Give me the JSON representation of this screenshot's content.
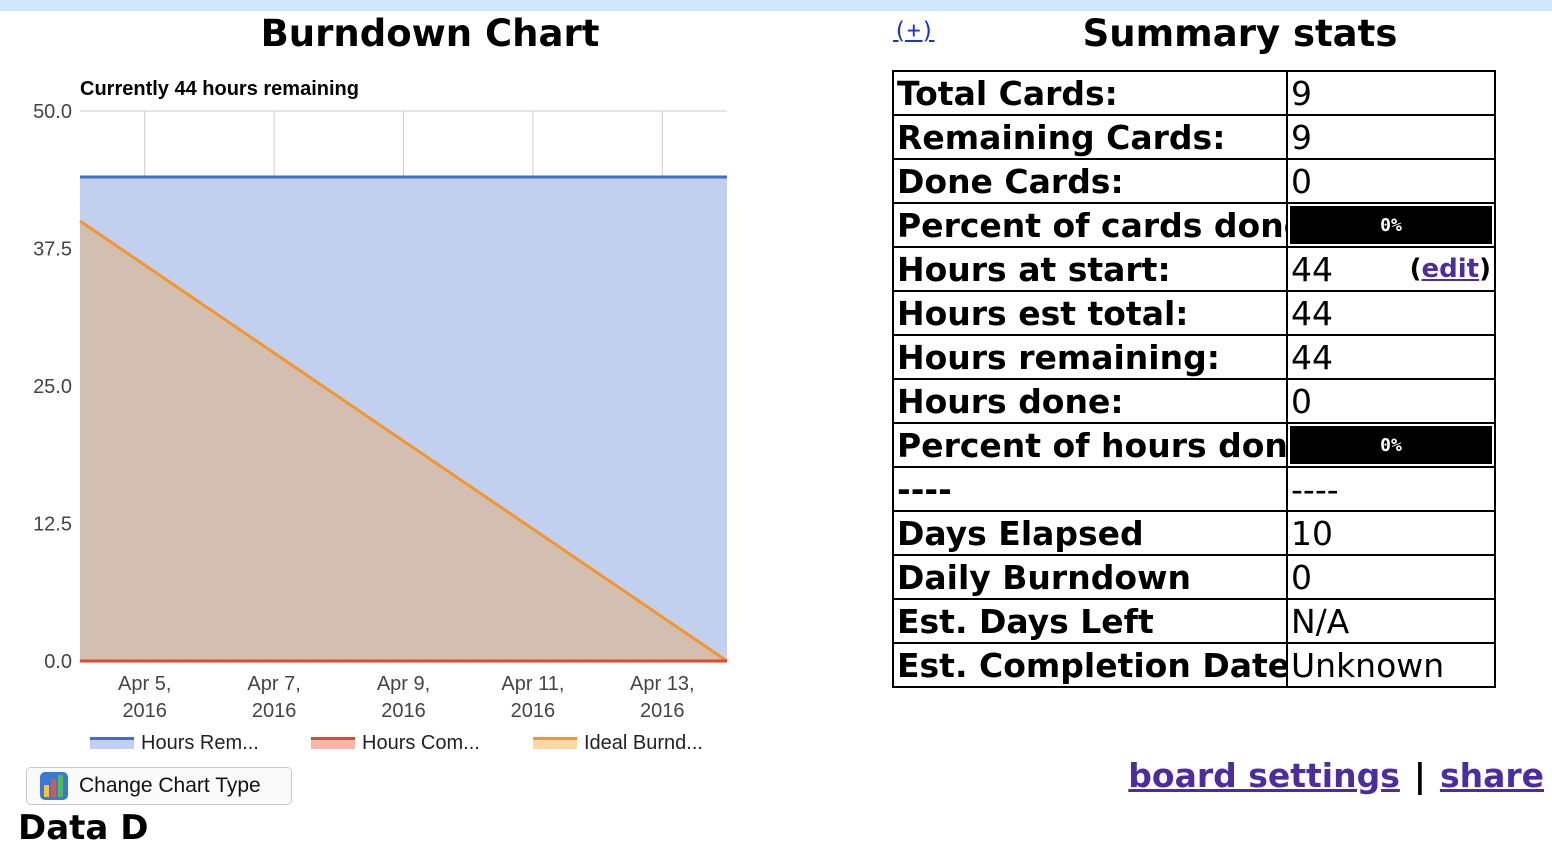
{
  "chart": {
    "title": "Burndown Chart",
    "subtitle": "Currently 44 hours remaining",
    "change_type_label": "Change Chart Type"
  },
  "chart_data": {
    "type": "area",
    "title": "Currently 44 hours remaining",
    "x": [
      "2016-04-04",
      "2016-04-14"
    ],
    "xticks": [
      "Apr 5, 2016",
      "Apr 7, 2016",
      "Apr 9, 2016",
      "Apr 11, 2016",
      "Apr 13, 2016"
    ],
    "yticks": [
      "50.0",
      "37.5",
      "25.0",
      "12.5",
      "0.0"
    ],
    "ylim": [
      0,
      50
    ],
    "grid": true,
    "legend": "bottom",
    "series": [
      {
        "name": "Hours Rem...",
        "color": "#3d6fc9",
        "fill": "#c1d0ef",
        "values": [
          44,
          44
        ]
      },
      {
        "name": "Hours Com...",
        "color": "#e0482a",
        "fill": "#f3b8aa",
        "values": [
          0,
          0
        ]
      },
      {
        "name": "Ideal Burnd...",
        "color": "#f5962a",
        "fill": "#fcd6a6",
        "values": [
          40,
          0
        ]
      }
    ]
  },
  "expand_label": "(+)",
  "stats": {
    "title": "Summary stats",
    "rows": [
      {
        "label": "Total Cards:",
        "value": "9"
      },
      {
        "label": "Remaining Cards:",
        "value": "9"
      },
      {
        "label": "Done Cards:",
        "value": "0"
      },
      {
        "label": "Percent of cards done:",
        "value": "0%",
        "bar": true
      },
      {
        "label": "Hours at start:",
        "value": "44",
        "edit": true
      },
      {
        "label": "Hours est total:",
        "value": "44"
      },
      {
        "label": "Hours remaining:",
        "value": "44"
      },
      {
        "label": "Hours done:",
        "value": "0"
      },
      {
        "label": "Percent of hours done:",
        "value": "0%",
        "bar": true
      },
      {
        "label": "----",
        "value": "----"
      },
      {
        "label": "Days Elapsed",
        "value": "10"
      },
      {
        "label": "Daily Burndown",
        "value": "0"
      },
      {
        "label": "Est. Days Left",
        "value": "N/A"
      },
      {
        "label": "Est. Completion Date",
        "value": "Unknown"
      }
    ],
    "edit_label": "edit",
    "edit_open": "(",
    "edit_close": ")"
  },
  "links": {
    "board_settings": "board settings",
    "separator": "|",
    "share": "share"
  },
  "bottom_cut_text": "Data D"
}
